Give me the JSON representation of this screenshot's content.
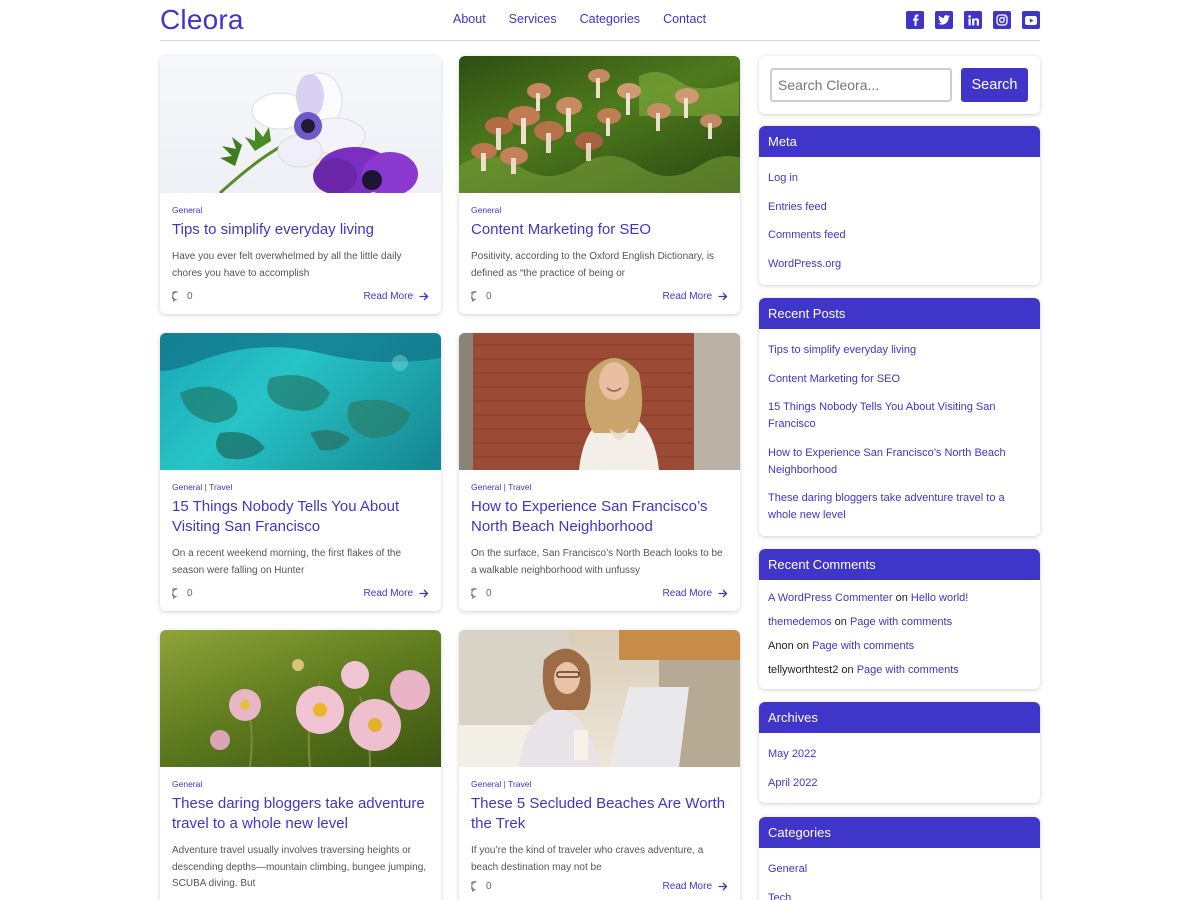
{
  "site": {
    "logo": "Cleora"
  },
  "nav": [
    "About",
    "Services",
    "Categories",
    "Contact"
  ],
  "social": [
    "facebook-icon",
    "twitter-icon",
    "linkedin-icon",
    "instagram-icon",
    "youtube-icon"
  ],
  "posts": [
    {
      "cats": [
        "General"
      ],
      "title": "Tips to simplify everyday living",
      "excerpt": "Have you ever felt overwhelmed by all the little daily chores you have to accomplish",
      "comments": "0",
      "read_more": "Read More"
    },
    {
      "cats": [
        "General"
      ],
      "title": "Content Marketing for SEO",
      "excerpt": "Positivity, according to the Oxford English Dictionary, is defined as “the practice of being or",
      "comments": "0",
      "read_more": "Read More"
    },
    {
      "cats": [
        "General",
        "Travel"
      ],
      "title": "15 Things Nobody Tells You About Visiting San Francisco",
      "excerpt": "On a recent weekend morning, the first flakes of the season were falling on Hunter",
      "comments": "0",
      "read_more": "Read More"
    },
    {
      "cats": [
        "General",
        "Travel"
      ],
      "title": "How to Experience San Francisco’s North Beach Neighborhood",
      "excerpt": "On the surface, San Francisco’s North Beach looks to be a walkable neighborhood with unfussy",
      "comments": "0",
      "read_more": "Read More"
    },
    {
      "cats": [
        "General"
      ],
      "title": "These daring bloggers take adventure travel to a whole new level",
      "excerpt": "Adventure travel usually involves traversing heights or descending depths—mountain climbing, bungee jumping, SCUBA diving. But",
      "comments": "",
      "read_more": ""
    },
    {
      "cats": [
        "General",
        "Travel"
      ],
      "title": "These 5 Secluded Beaches Are Worth the Trek",
      "excerpt": "If you’re the kind of traveler who craves adventure, a beach destination may not be",
      "comments": "0",
      "read_more": "Read More"
    }
  ],
  "cat_separator": "|",
  "search": {
    "placeholder": "Search Cleora...",
    "button": "Search"
  },
  "widgets": {
    "meta": {
      "title": "Meta",
      "items": [
        "Log in",
        "Entries feed",
        "Comments feed",
        "WordPress.org"
      ]
    },
    "recent_posts": {
      "title": "Recent Posts",
      "items": [
        "Tips to simplify everyday living",
        "Content Marketing for SEO",
        "15 Things Nobody Tells You About Visiting San Francisco",
        "How to Experience San Francisco’s North Beach Neighborhood",
        "These daring bloggers take adventure travel to a whole new level"
      ]
    },
    "recent_comments": {
      "title": "Recent Comments",
      "items": [
        {
          "author": "A WordPress Commenter",
          "author_link": true,
          "on": "on",
          "post": "Hello world!"
        },
        {
          "author": "themedemos",
          "author_link": true,
          "on": "on",
          "post": "Page with comments"
        },
        {
          "author": "Anon",
          "author_link": false,
          "on": "on",
          "post": "Page with comments"
        },
        {
          "author": "tellyworthtest2",
          "author_link": false,
          "on": "on",
          "post": "Page with comments"
        }
      ]
    },
    "archives": {
      "title": "Archives",
      "items": [
        "May 2022",
        "April 2022"
      ]
    },
    "categories": {
      "title": "Categories",
      "items": [
        "General",
        "Tech"
      ]
    }
  },
  "colors": {
    "accent": "#3f35c9"
  }
}
